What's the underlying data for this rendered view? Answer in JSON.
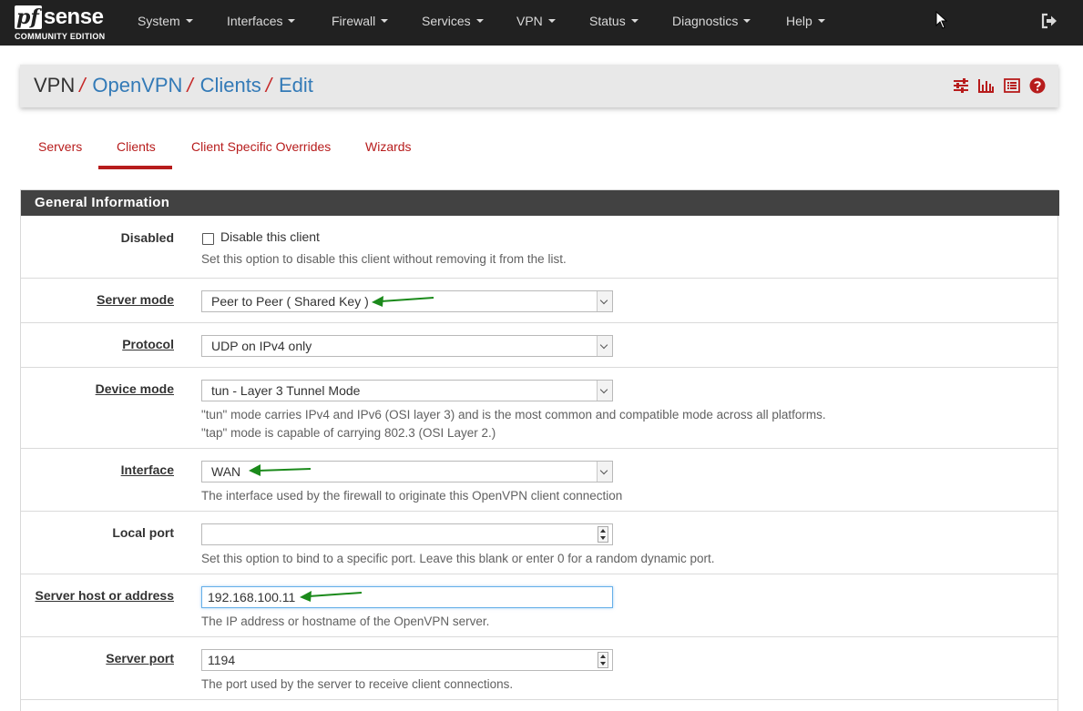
{
  "brand": {
    "name_pf": "pf",
    "name_sense": "sense",
    "edition": "COMMUNITY EDITION"
  },
  "nav": {
    "items": [
      "System",
      "Interfaces",
      "Firewall",
      "Services",
      "VPN",
      "Status",
      "Diagnostics",
      "Help"
    ]
  },
  "breadcrumb": {
    "root": "VPN",
    "items": [
      "OpenVPN",
      "Clients",
      "Edit"
    ],
    "separator": "/"
  },
  "header_icons": [
    "sliders-icon",
    "bar-chart-icon",
    "list-icon",
    "help-circle-icon"
  ],
  "tabs": [
    {
      "label": "Servers",
      "active": false
    },
    {
      "label": "Clients",
      "active": true
    },
    {
      "label": "Client Specific Overrides",
      "active": false
    },
    {
      "label": "Wizards",
      "active": false
    }
  ],
  "section": {
    "title": "General Information"
  },
  "fields": {
    "disabled": {
      "label": "Disabled",
      "checkbox_label": "Disable this client",
      "checked": false,
      "help": "Set this option to disable this client without removing it from the list."
    },
    "server_mode": {
      "label": "Server mode",
      "value": "Peer to Peer ( Shared Key )"
    },
    "protocol": {
      "label": "Protocol",
      "value": "UDP on IPv4 only"
    },
    "device_mode": {
      "label": "Device mode",
      "value": "tun - Layer 3 Tunnel Mode",
      "help1": "\"tun\" mode carries IPv4 and IPv6 (OSI layer 3) and is the most common and compatible mode across all platforms.",
      "help2": "\"tap\" mode is capable of carrying 802.3 (OSI Layer 2.)"
    },
    "interface": {
      "label": "Interface",
      "value": "WAN",
      "help": "The interface used by the firewall to originate this OpenVPN client connection"
    },
    "local_port": {
      "label": "Local port",
      "value": "",
      "help": "Set this option to bind to a specific port. Leave this blank or enter 0 for a random dynamic port."
    },
    "server_host": {
      "label": "Server host or address",
      "value": "192.168.100.11",
      "help": "The IP address or hostname of the OpenVPN server."
    },
    "server_port": {
      "label": "Server port",
      "value": "1194",
      "help": "The port used by the server to receive client connections."
    }
  },
  "colors": {
    "navbar": "#212121",
    "accent_red": "#b71c1c",
    "link_blue": "#337ab7",
    "section_header": "#424242",
    "annotation_arrow": "#1b8a1b"
  }
}
